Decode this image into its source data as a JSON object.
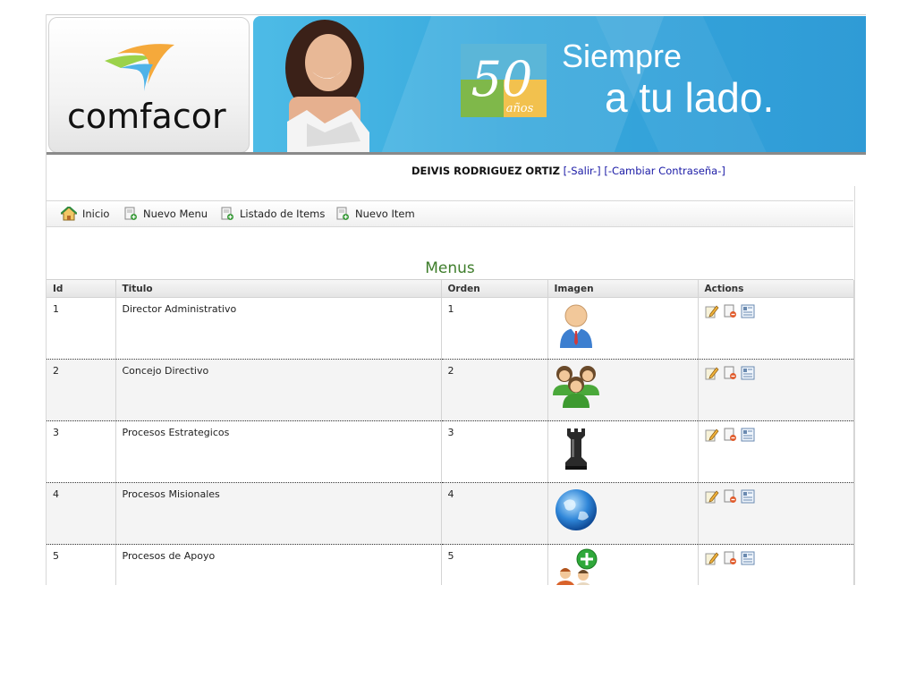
{
  "banner": {
    "logo_text": "comfacor",
    "badge_number": "50",
    "badge_years": "años",
    "slogan_line1": "Siempre",
    "slogan_line2": "a tu lado."
  },
  "user": {
    "name": "DEIVIS RODRIGUEZ ORTIZ",
    "logout_label": "[-Salir-]",
    "change_password_label": "[-Cambiar Contraseña-]"
  },
  "nav": {
    "items": [
      {
        "label": "Inicio",
        "icon": "home-icon"
      },
      {
        "label": "Nuevo Menu",
        "icon": "new-document-icon"
      },
      {
        "label": "Listado de Items",
        "icon": "new-document-icon"
      },
      {
        "label": "Nuevo Item",
        "icon": "new-document-icon"
      }
    ]
  },
  "page": {
    "title": "Menus"
  },
  "table": {
    "headers": [
      "Id",
      "Titulo",
      "Orden",
      "Imagen",
      "Actions"
    ],
    "rows": [
      {
        "id": "1",
        "titulo": "Director Administrativo",
        "orden": "1",
        "imagen": "businessman-icon"
      },
      {
        "id": "2",
        "titulo": "Concejo Directivo",
        "orden": "2",
        "imagen": "group-icon"
      },
      {
        "id": "3",
        "titulo": "Procesos Estrategicos",
        "orden": "3",
        "imagen": "chess-rook-icon"
      },
      {
        "id": "4",
        "titulo": "Procesos Misionales",
        "orden": "4",
        "imagen": "globe-icon"
      },
      {
        "id": "5",
        "titulo": "Procesos de Apoyo",
        "orden": "5",
        "imagen": "add-users-icon"
      }
    ],
    "action_icons": [
      "edit-icon",
      "delete-icon",
      "details-icon"
    ]
  },
  "colors": {
    "title_green": "#3e7d2b",
    "link_blue": "#1a1aa6",
    "banner_blue": "#36a7dc"
  }
}
